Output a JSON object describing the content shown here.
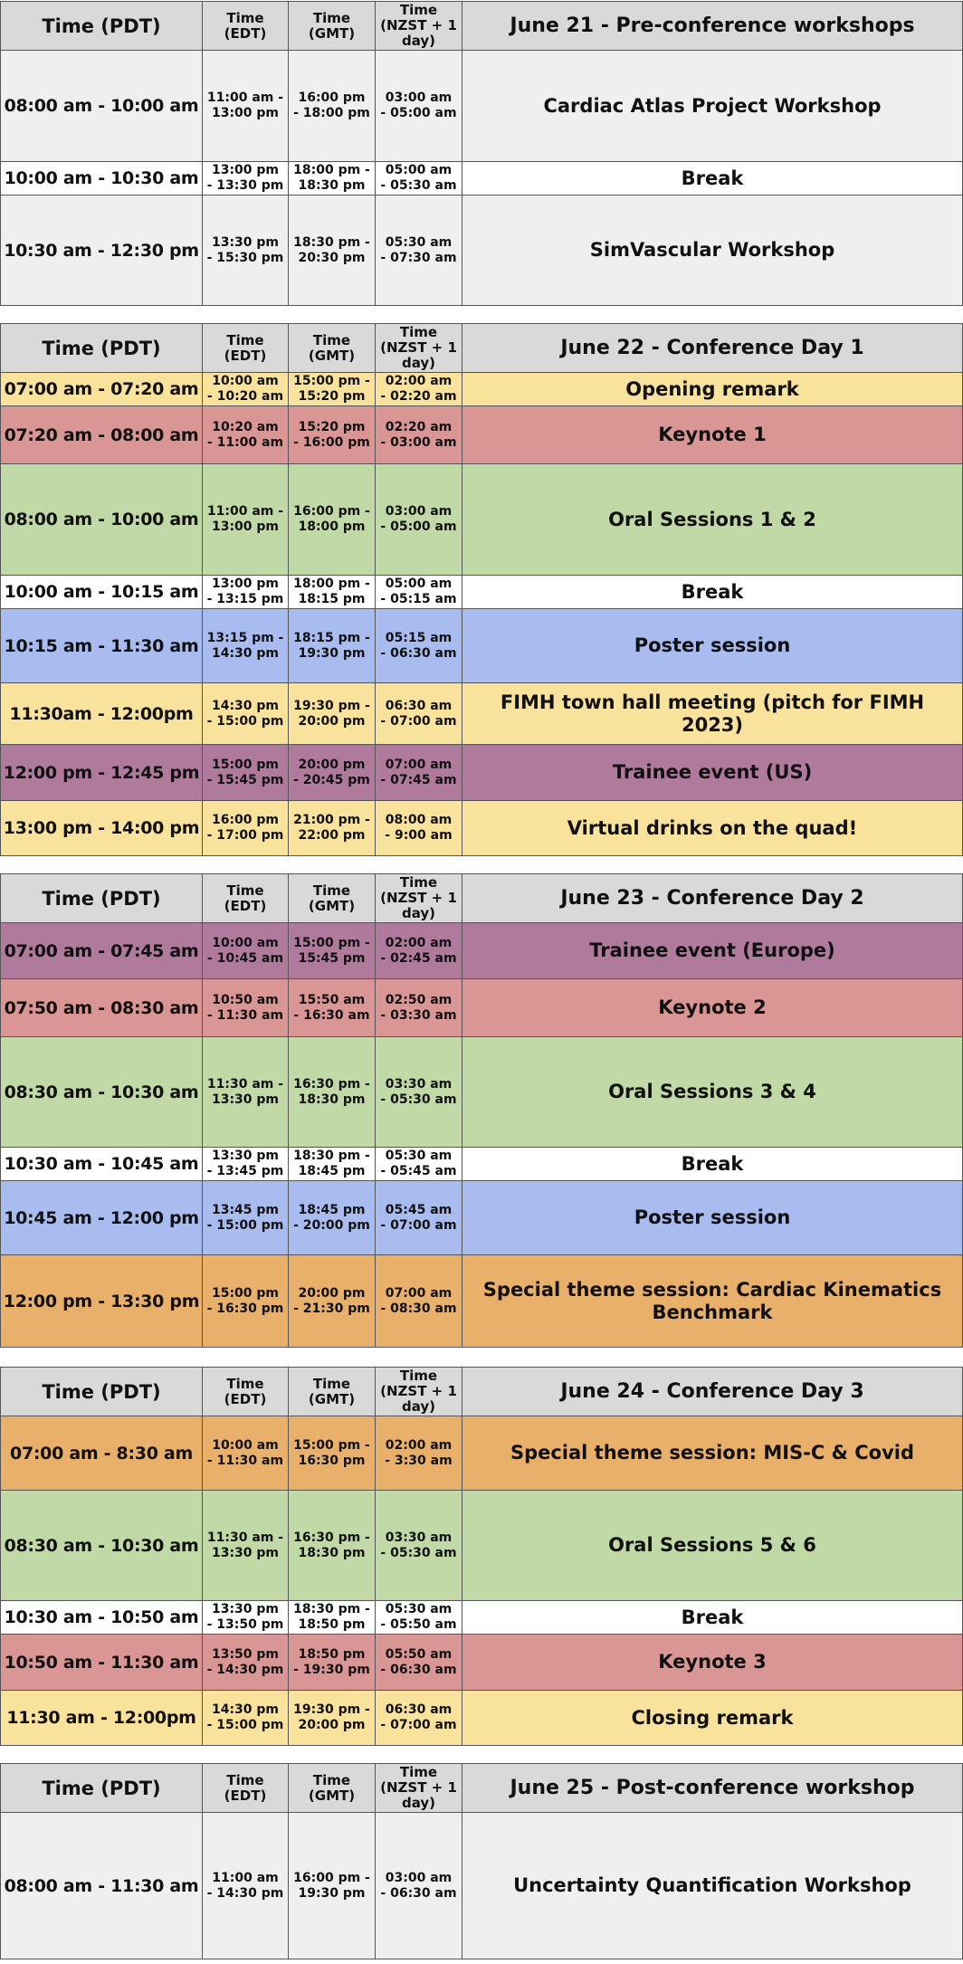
{
  "colors": {
    "header": "#d9d9d9",
    "workshop": "#efefef",
    "break": "#ffffff",
    "yellow": "#f9e29c",
    "red": "#da9694",
    "green": "#c1d9a7",
    "blue": "#a9bcf0",
    "purple": "#b07a9c",
    "orange": "#e8b06b"
  },
  "headers": {
    "pdt": "Time (PDT)",
    "edt": "Time\n(EDT)",
    "gmt": "Time\n(GMT)",
    "nzst": "Time\n(NZST + 1\nday)"
  },
  "days": [
    {
      "title": "June 21 - Pre-conference workshops",
      "rows": [
        {
          "pdt": "08:00 am - 10:00 am",
          "edt": "11:00 am -\n13:00 pm",
          "gmt": "16:00 pm\n- 18:00 pm",
          "nzst": "03:00 am\n- 05:00 am",
          "event": "Cardiac Atlas Project Workshop",
          "color": "workshop"
        },
        {
          "pdt": "10:00 am - 10:30 am",
          "edt": "13:00 pm\n- 13:30 pm",
          "gmt": "18:00 pm -\n18:30 pm",
          "nzst": "05:00 am\n- 05:30 am",
          "event": "Break",
          "color": "break"
        },
        {
          "pdt": "10:30 am - 12:30 pm",
          "edt": "13:30 pm\n- 15:30 pm",
          "gmt": "18:30 pm -\n20:30 pm",
          "nzst": "05:30 am\n- 07:30 am",
          "event": "SimVascular Workshop",
          "color": "workshop"
        }
      ]
    },
    {
      "title": "June 22 - Conference Day 1",
      "rows": [
        {
          "pdt": "07:00 am - 07:20 am",
          "edt": "10:00 am\n- 10:20 am",
          "gmt": "15:00 pm -\n15:20 pm",
          "nzst": "02:00 am\n- 02:20 am",
          "event": "Opening remark",
          "color": "yellow"
        },
        {
          "pdt": "07:20 am - 08:00 am",
          "edt": "10:20 am\n- 11:00 am",
          "gmt": "15:20 pm\n- 16:00 pm",
          "nzst": "02:20 am\n- 03:00 am",
          "event": "Keynote 1",
          "color": "red"
        },
        {
          "pdt": "08:00 am - 10:00 am",
          "edt": "11:00 am -\n13:00 pm",
          "gmt": "16:00 pm -\n18:00 pm",
          "nzst": "03:00 am\n- 05:00 am",
          "event": "Oral Sessions 1 & 2",
          "color": "green"
        },
        {
          "pdt": "10:00 am - 10:15 am",
          "edt": "13:00 pm\n- 13:15 pm",
          "gmt": "18:00 pm -\n18:15 pm",
          "nzst": "05:00 am\n- 05:15 am",
          "event": "Break",
          "color": "break"
        },
        {
          "pdt": "10:15 am - 11:30 am",
          "edt": "13:15 pm -\n14:30 pm",
          "gmt": "18:15 pm -\n19:30 pm",
          "nzst": "05:15 am\n- 06:30 am",
          "event": "Poster session",
          "color": "blue"
        },
        {
          "pdt": "11:30am - 12:00pm",
          "edt": "14:30 pm\n- 15:00 pm",
          "gmt": "19:30 pm -\n20:00 pm",
          "nzst": "06:30 am\n- 07:00 am",
          "event": "FIMH town hall meeting (pitch for FIMH 2023)",
          "color": "yellow"
        },
        {
          "pdt": "12:00 pm - 12:45 pm",
          "edt": "15:00 pm\n- 15:45 pm",
          "gmt": "20:00 pm\n- 20:45 pm",
          "nzst": "07:00 am\n- 07:45 am",
          "event": "Trainee event (US)",
          "color": "purple"
        },
        {
          "pdt": "13:00 pm - 14:00 pm",
          "edt": "16:00 pm\n- 17:00 pm",
          "gmt": "21:00 pm -\n22:00 pm",
          "nzst": "08:00 am\n- 9:00 am",
          "event": "Virtual drinks on the quad!",
          "color": "yellow"
        }
      ]
    },
    {
      "title": "June 23 - Conference Day 2",
      "rows": [
        {
          "pdt": "07:00 am - 07:45 am",
          "edt": "10:00 am\n- 10:45 am",
          "gmt": "15:00 pm -\n15:45 pm",
          "nzst": "02:00 am\n- 02:45 am",
          "event": "Trainee event (Europe)",
          "color": "purple"
        },
        {
          "pdt": "07:50 am - 08:30 am",
          "edt": "10:50 am\n- 11:30 am",
          "gmt": "15:50 am\n- 16:30 am",
          "nzst": "02:50 am\n- 03:30 am",
          "event": "Keynote 2",
          "color": "red"
        },
        {
          "pdt": "08:30 am - 10:30 am",
          "edt": "11:30 am -\n13:30 pm",
          "gmt": "16:30 pm -\n18:30 pm",
          "nzst": "03:30 am\n- 05:30 am",
          "event": "Oral Sessions 3 & 4",
          "color": "green"
        },
        {
          "pdt": "10:30 am - 10:45 am",
          "edt": "13:30 pm\n- 13:45 pm",
          "gmt": "18:30 pm -\n18:45 pm",
          "nzst": "05:30 am\n- 05:45 am",
          "event": "Break",
          "color": "break"
        },
        {
          "pdt": "10:45 am - 12:00 pm",
          "edt": "13:45 pm\n- 15:00 pm",
          "gmt": "18:45 pm\n- 20:00 pm",
          "nzst": "05:45 am\n- 07:00 am",
          "event": "Poster session",
          "color": "blue"
        },
        {
          "pdt": "12:00 pm - 13:30 pm",
          "edt": "15:00 pm\n- 16:30 pm",
          "gmt": "20:00 pm\n- 21:30 pm",
          "nzst": "07:00 am\n- 08:30 am",
          "event": "Special theme session: Cardiac Kinematics Benchmark",
          "color": "orange"
        }
      ]
    },
    {
      "title": "June 24 - Conference Day 3",
      "rows": [
        {
          "pdt": "07:00 am - 8:30 am",
          "edt": "10:00 am\n- 11:30 am",
          "gmt": "15:00 pm -\n16:30 pm",
          "nzst": "02:00 am\n- 3:30 am",
          "event": "Special theme session: MIS-C & Covid",
          "color": "orange"
        },
        {
          "pdt": "08:30 am - 10:30 am",
          "edt": "11:30 am -\n13:30 pm",
          "gmt": "16:30 pm -\n18:30 pm",
          "nzst": "03:30 am\n- 05:30 am",
          "event": "Oral Sessions 5 & 6",
          "color": "green"
        },
        {
          "pdt": "10:30 am - 10:50 am",
          "edt": "13:30 pm\n- 13:50 pm",
          "gmt": "18:30 pm -\n18:50 pm",
          "nzst": "05:30 am\n- 05:50 am",
          "event": "Break",
          "color": "break"
        },
        {
          "pdt": "10:50 am - 11:30 am",
          "edt": "13:50 pm\n- 14:30 pm",
          "gmt": "18:50 pm\n- 19:30 pm",
          "nzst": "05:50 am\n- 06:30 am",
          "event": "Keynote 3",
          "color": "red"
        },
        {
          "pdt": "11:30 am - 12:00pm",
          "edt": "14:30 pm\n- 15:00 pm",
          "gmt": "19:30 pm -\n20:00 pm",
          "nzst": "06:30 am\n- 07:00 am",
          "event": "Closing remark",
          "color": "yellow"
        }
      ]
    },
    {
      "title": "June 25 - Post-conference workshop",
      "rows": [
        {
          "pdt": "08:00 am - 11:30 am",
          "edt": "11:00  am\n- 14:30 pm",
          "gmt": "16:00 pm -\n19:30 pm",
          "nzst": "03:00 am\n- 06:30 am",
          "event": "Uncertainty Quantification Workshop",
          "color": "workshop"
        }
      ]
    }
  ]
}
